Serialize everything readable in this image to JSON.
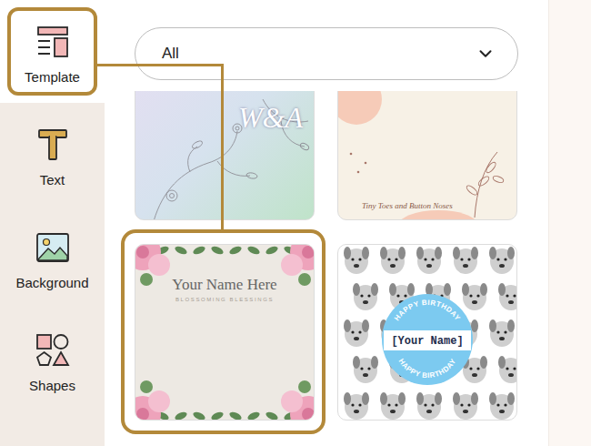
{
  "sidebar": {
    "items": [
      {
        "label": "Template",
        "selected": true
      },
      {
        "label": "Text",
        "selected": false
      },
      {
        "label": "Background",
        "selected": false
      },
      {
        "label": "Shapes",
        "selected": false
      }
    ]
  },
  "filter": {
    "value": "All"
  },
  "templates": [
    {
      "kind": "monogram",
      "title": "W&A",
      "selected": false
    },
    {
      "kind": "baby",
      "title": "Tiny Toes and Button Noses",
      "selected": false
    },
    {
      "kind": "floral",
      "title": "Your Name Here",
      "subtitle": "BLOSSOMING BLESSINGS",
      "selected": true
    },
    {
      "kind": "birthday",
      "title": "[Your Name]",
      "banner": "HAPPY BIRTHDAY",
      "selected": false
    }
  ]
}
